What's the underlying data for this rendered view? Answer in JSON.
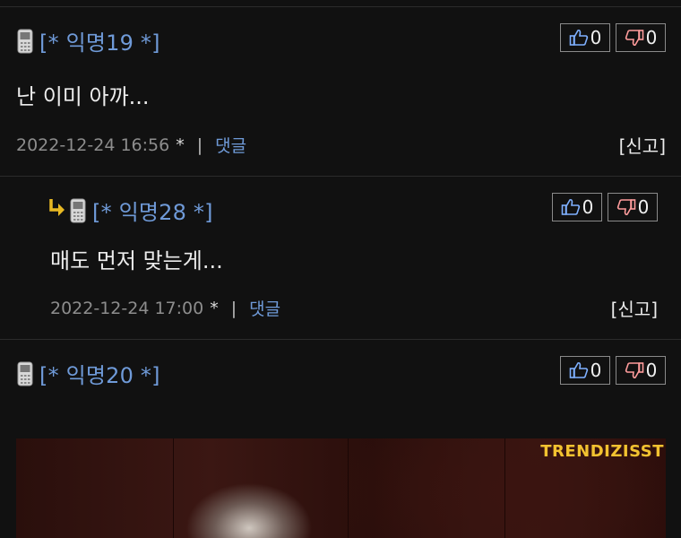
{
  "comments": [
    {
      "author": "[* 익명19 *]",
      "is_reply": false,
      "likes": "0",
      "dislikes": "0",
      "body": "난 이미 아까...",
      "date": "2022-12-24 16:56",
      "star": "*",
      "separator": "|",
      "reply_label": "댓글",
      "report_label": "[신고]"
    },
    {
      "author": "[* 익명28 *]",
      "is_reply": true,
      "likes": "0",
      "dislikes": "0",
      "body": "매도 먼저 맞는게...",
      "date": "2022-12-24 17:00",
      "star": "*",
      "separator": "|",
      "reply_label": "댓글",
      "report_label": "[신고]"
    },
    {
      "author": "[* 익명20 *]",
      "is_reply": false,
      "likes": "0",
      "dislikes": "0",
      "image_watermark": "TRENDIZISST"
    }
  ],
  "icons": {
    "mobile": "mobile-phone-icon",
    "like": "thumbs-up-icon",
    "dislike": "thumbs-down-icon",
    "reply": "reply-arrow-icon"
  },
  "colors": {
    "background": "#111111",
    "author": "#6f9ad8",
    "reply_arrow": "#e8b923",
    "watermark": "#f2c230"
  }
}
